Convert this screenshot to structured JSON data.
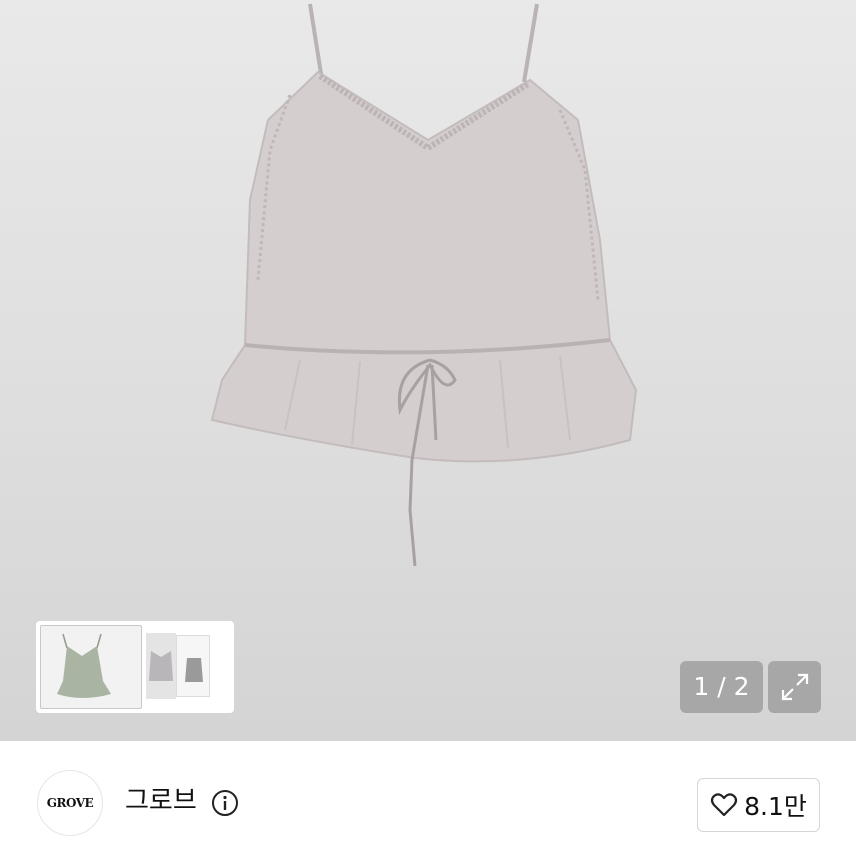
{
  "gallery": {
    "page_counter": "1 / 2",
    "expand_icon": "expand-arrows-icon"
  },
  "shop": {
    "logo_text": "GROVE",
    "name": "그로브",
    "info_icon": "info-circle-icon",
    "like_icon": "heart-outline-icon",
    "like_count": "8.1만"
  }
}
